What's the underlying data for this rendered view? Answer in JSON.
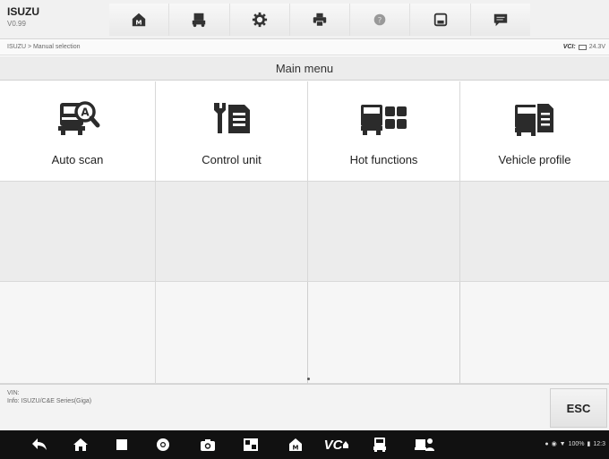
{
  "header": {
    "title": "ISUZU",
    "version": "V0.99"
  },
  "toolbar": {
    "buttons": [
      {
        "icon": "home-icon"
      },
      {
        "icon": "vehicle-swap-icon"
      },
      {
        "icon": "settings-gear-icon"
      },
      {
        "icon": "print-icon"
      },
      {
        "icon": "help-icon"
      },
      {
        "icon": "save-icon"
      },
      {
        "icon": "data-logging-icon"
      }
    ]
  },
  "breadcrumb": "ISUZU > Manual selection",
  "vci_status": {
    "label": "VCI:",
    "voltage": "24.3V"
  },
  "page_title": "Main menu",
  "menu_items": [
    {
      "label": "Auto scan",
      "icon": "auto-scan-icon"
    },
    {
      "label": "Control unit",
      "icon": "control-unit-icon"
    },
    {
      "label": "Hot functions",
      "icon": "hot-functions-icon"
    },
    {
      "label": "Vehicle profile",
      "icon": "vehicle-profile-icon"
    }
  ],
  "info": {
    "vin": "VIN:",
    "model": "Info: ISUZU/C&E Series(Giga)"
  },
  "esc_label": "ESC",
  "navbar": {
    "vci_label": "VC",
    "battery": "100%",
    "time": "12:3"
  }
}
